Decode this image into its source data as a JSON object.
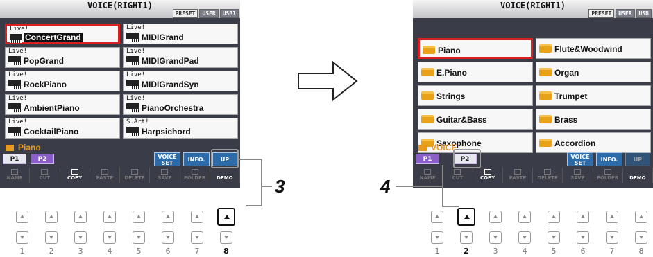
{
  "left_screen": {
    "title": "VOICE(RIGHT1)",
    "tabs": [
      "PRESET",
      "USER",
      "USB1"
    ],
    "voices": [
      {
        "tag": "Live!",
        "name": "ConcertGrand"
      },
      {
        "tag": "Live!",
        "name": "MIDIGrand"
      },
      {
        "tag": "Live!",
        "name": "PopGrand"
      },
      {
        "tag": "Live!",
        "name": "MIDIGrandPad"
      },
      {
        "tag": "Live!",
        "name": "RockPiano"
      },
      {
        "tag": "Live!",
        "name": "MIDIGrandSyn"
      },
      {
        "tag": "Live!",
        "name": "AmbientPiano"
      },
      {
        "tag": "Live!",
        "name": "PianoOrchestra"
      },
      {
        "tag": "Live!",
        "name": "CocktailPiano"
      },
      {
        "tag": "S.Art!",
        "name": "Harpsichord"
      }
    ],
    "bank": "Piano",
    "page_buttons": [
      "P1",
      "P2"
    ],
    "voice_set": "VOICE SET",
    "info": "INFO.",
    "up": "UP",
    "functions": [
      "NAME",
      "CUT",
      "COPY",
      "PASTE",
      "DELETE",
      "SAVE",
      "FOLDER",
      "DEMO"
    ]
  },
  "right_screen": {
    "title": "VOICE(RIGHT1)",
    "tabs": [
      "PRESET",
      "USER",
      "USB"
    ],
    "categories": [
      "Piano",
      "Flute&Woodwind",
      "E.Piano",
      "Organ",
      "Strings",
      "Trumpet",
      "Guitar&Bass",
      "Brass",
      "Saxophone",
      "Accordion"
    ],
    "bank": "VOICE",
    "page_buttons": [
      "P1",
      "P2"
    ],
    "voice_set": "VOICE SET",
    "info": "INFO.",
    "up": "UP",
    "functions": [
      "NAME",
      "CUT",
      "COPY",
      "PASTE",
      "DELETE",
      "SAVE",
      "FOLDER",
      "DEMO"
    ]
  },
  "steps": {
    "left": "3",
    "right": "4"
  },
  "button_numbers": [
    "1",
    "2",
    "3",
    "4",
    "5",
    "6",
    "7",
    "8"
  ],
  "colors": {
    "selection_border": "#d92020",
    "folder": "#e8a21a",
    "screen_bg": "#3a3c48"
  }
}
